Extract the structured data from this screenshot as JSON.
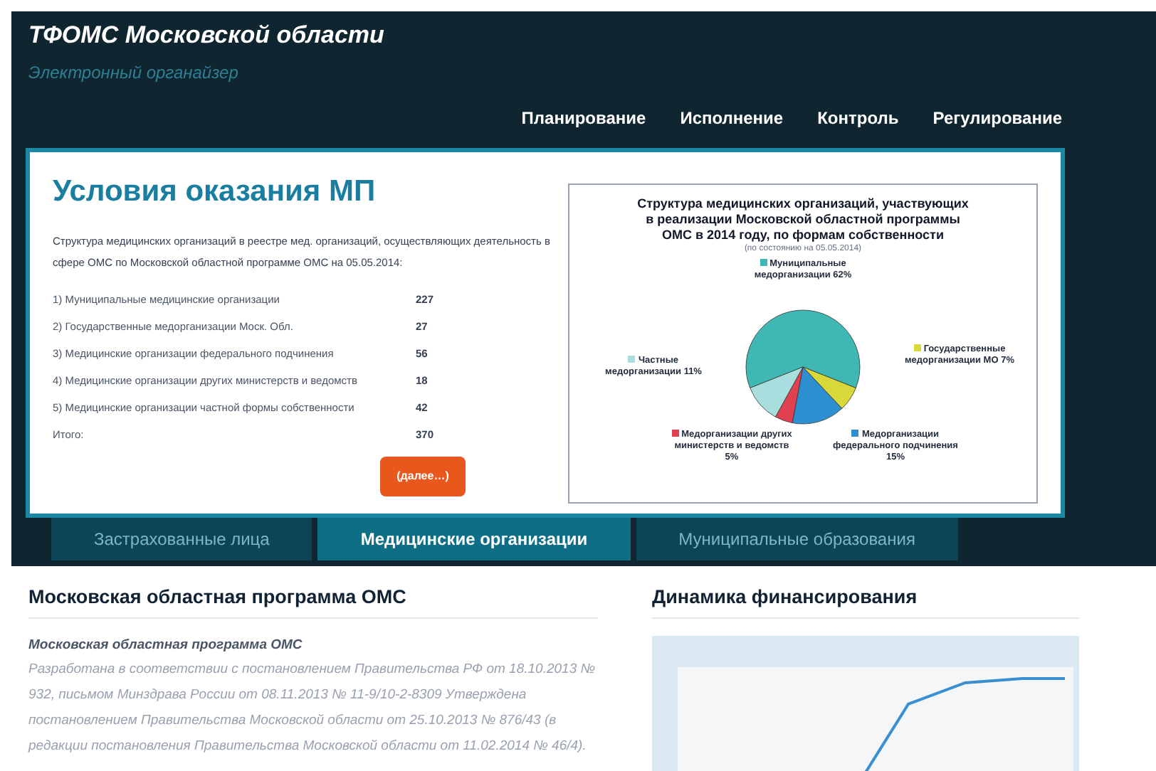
{
  "site": {
    "title": "ТФОМС Московской области",
    "subtitle": "Электронный органайзер"
  },
  "nav": [
    {
      "label": "Планирование"
    },
    {
      "label": "Исполнение"
    },
    {
      "label": "Контроль"
    },
    {
      "label": "Регулирование"
    }
  ],
  "conditions": {
    "heading": "Условия оказания МП",
    "intro": "Структура медицинских организаций в реестре мед. организаций, осуществляющих деятельность в сфере ОМС по Московской областной программе ОМС на 05.05.2014:",
    "rows": [
      {
        "label": "1) Муниципальные медицинские организации",
        "value": "227"
      },
      {
        "label": "2) Государственные медорганизации Моск. Обл.",
        "value": "27"
      },
      {
        "label": "3) Медицинские организации федерального подчинения",
        "value": "56"
      },
      {
        "label": "4) Медицинские организации других министерств и ведомств",
        "value": "18"
      },
      {
        "label": "5) Медицинские организации частной формы собственности",
        "value": "42"
      },
      {
        "label": "Итого:",
        "value": "370"
      }
    ],
    "more_button": "(далее…)",
    "chart_data": {
      "type": "pie",
      "title": "Структура медицинских организаций, участвующих в реализации Московской областной программы ОМС в 2014 году, по формам собственности",
      "subtitle": "(по состоянию на 05.05.2014)",
      "legend": "top right",
      "categories": [
        "Муниципальные медорганизации",
        "Государственные медорганизации МО",
        "Медорганизации федерального подчинения",
        "Медорганизации других министерств и ведомств",
        "Частные медорганизации"
      ],
      "value_labels": [
        "62%",
        "7%",
        "15%",
        "5%",
        "11%"
      ],
      "values": [
        62,
        7,
        15,
        5,
        11
      ],
      "colors": [
        "#3fb8b4",
        "#d8d83a",
        "#2e8fd0",
        "#e04050",
        "#a8dede"
      ]
    }
  },
  "tabs": [
    {
      "label": "Застрахованные лица",
      "selected": false
    },
    {
      "label": "Медицинские организации",
      "selected": true
    },
    {
      "label": "Муниципальные образования",
      "selected": false
    }
  ],
  "program": {
    "heading": "Московская областная программа ОМС",
    "subheading": "Московская областная программа ОМС",
    "text": "Разработана в соответствии с постановлением Правительства РФ от 18.10.2013 № 932, письмом Минздрава России от 08.11.2013 № 11-9/10-2-8309 Утверждена постановлением Правительства Московской области от 25.10.2013 № 876/43 (в редакции постановления Правительства Московской области от 11.02.2014 № 46/4)."
  },
  "financing": {
    "heading": "Динамика финансирования"
  }
}
